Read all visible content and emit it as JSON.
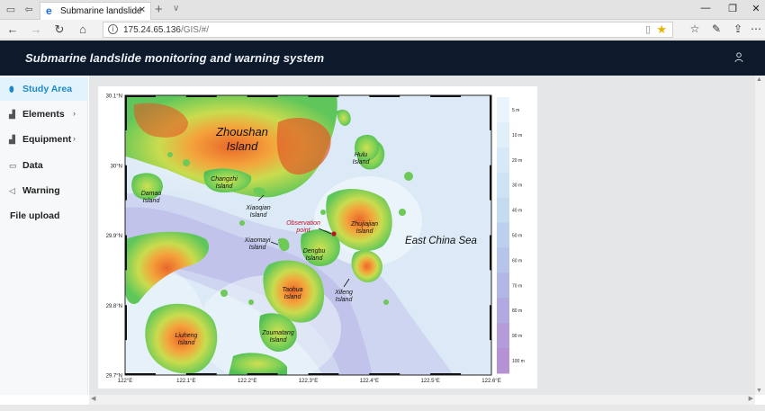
{
  "browser": {
    "tab_title": "Submarine landslide",
    "tab_close": "✕",
    "new_tab": "+",
    "tab_dropdown": "∨",
    "url_host": "175.24.65.136",
    "url_path": "/GIS/#/",
    "win_minimize": "—",
    "win_restore": "❐",
    "win_close": "✕"
  },
  "app": {
    "title": "Submarine landslide monitoring and warning system"
  },
  "sidebar": {
    "items": [
      {
        "label": "Study Area",
        "icon": "location-pin-icon",
        "active": true,
        "has_submenu": false
      },
      {
        "label": "Elements",
        "icon": "bar-chart-icon",
        "active": false,
        "has_submenu": true
      },
      {
        "label": "Equipment",
        "icon": "bar-chart-icon",
        "active": false,
        "has_submenu": true
      },
      {
        "label": "Data",
        "icon": "monitor-icon",
        "active": false,
        "has_submenu": false
      },
      {
        "label": "Warning",
        "icon": "megaphone-icon",
        "active": false,
        "has_submenu": false
      },
      {
        "label": "File upload",
        "icon": "",
        "active": false,
        "has_submenu": false
      }
    ]
  },
  "map": {
    "islands": [
      {
        "name_lines": [
          "Zhoushan",
          "Island"
        ]
      },
      {
        "name_lines": [
          "Hulu",
          "Island"
        ]
      },
      {
        "name_lines": [
          "Changzhi",
          "Island"
        ]
      },
      {
        "name_lines": [
          "Damao",
          "Island"
        ]
      },
      {
        "name_lines": [
          "Xiaoqian",
          "Island"
        ]
      },
      {
        "name_lines": [
          "Zhujiajian",
          "Island"
        ]
      },
      {
        "name_lines": [
          "Xiaomayi",
          "Island"
        ]
      },
      {
        "name_lines": [
          "Dengbu",
          "Island"
        ]
      },
      {
        "name_lines": [
          "Taohua",
          "Island"
        ]
      },
      {
        "name_lines": [
          "Xifeng",
          "Island"
        ]
      },
      {
        "name_lines": [
          "Liuheng",
          "Island"
        ]
      },
      {
        "name_lines": [
          "Zoumatang",
          "Island"
        ]
      }
    ],
    "sea_label": "East China Sea",
    "observation_label_lines": [
      "Observation",
      "point"
    ],
    "lat_ticks": [
      "30.1°N",
      "30°N",
      "29.9°N",
      "29.8°N",
      "29.7°N"
    ],
    "lon_ticks": [
      "122°E",
      "122.1°E",
      "122.2°E",
      "122.3°E",
      "122.4°E",
      "122.5°E",
      "122.6°E"
    ],
    "depth_legend": [
      "5 m",
      "10 m",
      "20 m",
      "30 m",
      "40 m",
      "50 m",
      "60 m",
      "70 m",
      "80 m",
      "90 m",
      "100 m"
    ],
    "depth_colors": [
      "#eaf4fb",
      "#e1eff9",
      "#d7e9f6",
      "#cde2f3",
      "#c4dbf0",
      "#bccfec",
      "#b5c4e8",
      "#b1b6e3",
      "#b1a9df",
      "#b39cd8",
      "#b592d2"
    ],
    "sea_color": "#dbeaf6",
    "marker_color": "#c0102a"
  }
}
